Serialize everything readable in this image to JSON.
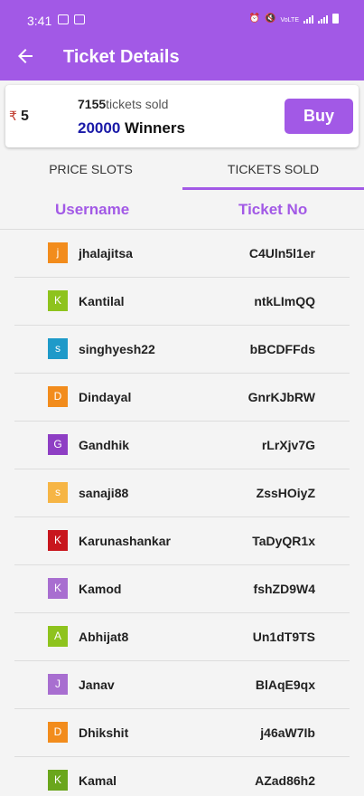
{
  "status": {
    "time": "3:41",
    "net_label": "VoLTE"
  },
  "appbar": {
    "title": "Ticket Details"
  },
  "card": {
    "currency": "₹",
    "price": "5",
    "tickets_sold": "7155",
    "tickets_sold_label": "tickets sold",
    "winners": "20000",
    "winners_label": "Winners",
    "buy_label": "Buy"
  },
  "tabs": [
    {
      "label": "PRICE SLOTS",
      "active": false
    },
    {
      "label": "TICKETS SOLD",
      "active": true
    }
  ],
  "columns": {
    "username": "Username",
    "ticket_no": "Ticket No"
  },
  "colors": {
    "accent": "#a259e6",
    "winners_blue": "#1a1aa8"
  },
  "rows": [
    {
      "initial": "j",
      "color": "#f28c1c",
      "username": "jhalajitsa",
      "ticket": "C4Uln5l1er"
    },
    {
      "initial": "K",
      "color": "#8ec31d",
      "username": "Kantilal",
      "ticket": "ntkLImQQ"
    },
    {
      "initial": "s",
      "color": "#1e9ac9",
      "username": "singhyesh22",
      "ticket": "bBCDFFds"
    },
    {
      "initial": "D",
      "color": "#f28c1c",
      "username": "Dindayal",
      "ticket": "GnrKJbRW"
    },
    {
      "initial": "G",
      "color": "#8e3ec4",
      "username": "Gandhik",
      "ticket": "rLrXjv7G"
    },
    {
      "initial": "s",
      "color": "#f6b545",
      "username": "sanaji88",
      "ticket": "ZssHOiyZ"
    },
    {
      "initial": "K",
      "color": "#c8161d",
      "username": "Karunashankar",
      "ticket": "TaDyQR1x"
    },
    {
      "initial": "K",
      "color": "#a86ed0",
      "username": "Kamod",
      "ticket": "fshZD9W4"
    },
    {
      "initial": "A",
      "color": "#8ec31d",
      "username": "Abhijat8",
      "ticket": "Un1dT9TS"
    },
    {
      "initial": "J",
      "color": "#a86ed0",
      "username": "Janav",
      "ticket": "BlAqE9qx"
    },
    {
      "initial": "D",
      "color": "#f28c1c",
      "username": "Dhikshit",
      "ticket": "j46aW7Ib"
    },
    {
      "initial": "K",
      "color": "#6aa61c",
      "username": "Kamal",
      "ticket": "AZad86h2"
    }
  ]
}
